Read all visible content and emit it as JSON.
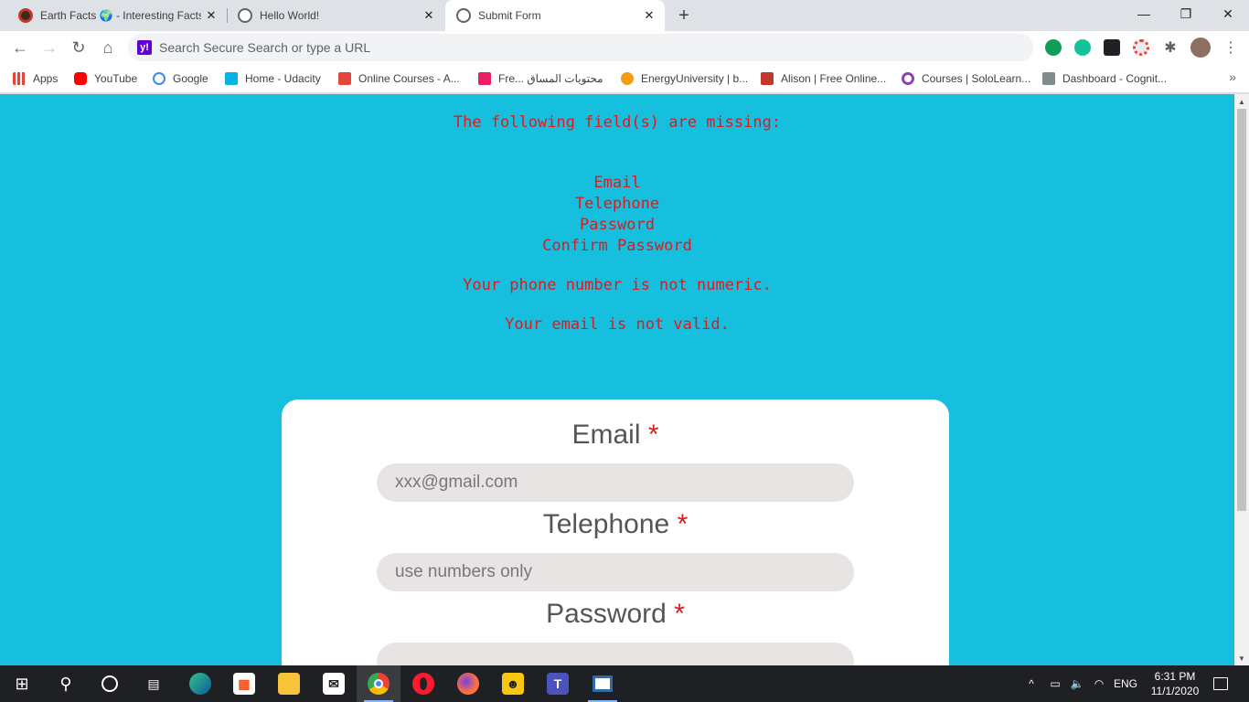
{
  "browser": {
    "tabs": [
      {
        "title": "Earth Facts 🌍 - Interesting Facts",
        "favicon_color": "#c0392b",
        "active": false
      },
      {
        "title": "Hello World!",
        "favicon_color": "#5f6368",
        "active": false
      },
      {
        "title": "Submit Form",
        "favicon_color": "#5f6368",
        "active": true
      }
    ],
    "newtab_label": "+",
    "window_controls": {
      "minimize": "—",
      "maximize": "❐",
      "close": "✕"
    },
    "address_placeholder": "Search Secure Search or type a URL",
    "address_value": ""
  },
  "bookmarks": [
    {
      "label": "Apps",
      "icon_color": "#ea4335",
      "icon": "apps-grid-icon"
    },
    {
      "label": "YouTube",
      "icon_color": "#ff0000",
      "icon": "youtube-icon"
    },
    {
      "label": "Google",
      "icon_color": "#4285f4",
      "icon": "google-icon"
    },
    {
      "label": "Home - Udacity",
      "icon_color": "#02b3e4",
      "icon": "udacity-icon"
    },
    {
      "label": "Online Courses - A...",
      "icon_color": "#e3453b",
      "icon": "courses-icon"
    },
    {
      "label": "Fre... محتويات المساق",
      "icon_color": "#e91e63",
      "icon": "edraak-icon"
    },
    {
      "label": "EnergyUniversity | b...",
      "icon_color": "#f39c12",
      "icon": "energy-icon"
    },
    {
      "label": "Alison | Free Online...",
      "icon_color": "#c0392b",
      "icon": "alison-icon"
    },
    {
      "label": "Courses | SoloLearn...",
      "icon_color": "#8e44ad",
      "icon": "sololearn-icon"
    },
    {
      "label": "Dashboard - Cognit...",
      "icon_color": "#7f8c8d",
      "icon": "cognitive-icon"
    }
  ],
  "page": {
    "error_heading": "The following field(s) are missing:",
    "missing_fields": [
      "Email",
      "Telephone",
      "Password",
      "Confirm Password"
    ],
    "phone_error": "Your phone number is not numeric.",
    "email_error": "Your email is not valid.",
    "form": {
      "required_marker": "*",
      "fields": [
        {
          "label": "Email",
          "placeholder": "xxx@gmail.com"
        },
        {
          "label": "Telephone",
          "placeholder": "use numbers only"
        },
        {
          "label": "Password",
          "placeholder": ""
        }
      ]
    },
    "colors": {
      "background": "#17bfdf",
      "error_text": "#e0191d",
      "card": "#ffffff",
      "input_bg": "#e8e4e4"
    }
  },
  "taskbar": {
    "language": "ENG",
    "time": "6:31 PM",
    "date": "11/1/2020",
    "apps": [
      "windows-start-icon",
      "search-icon",
      "cortana-icon",
      "task-view-icon",
      "edge-icon",
      "store-icon",
      "file-explorer-icon",
      "mail-icon",
      "chrome-icon",
      "opera-icon",
      "firefox-icon",
      "app-icon",
      "teams-icon",
      "window-icon"
    ]
  }
}
